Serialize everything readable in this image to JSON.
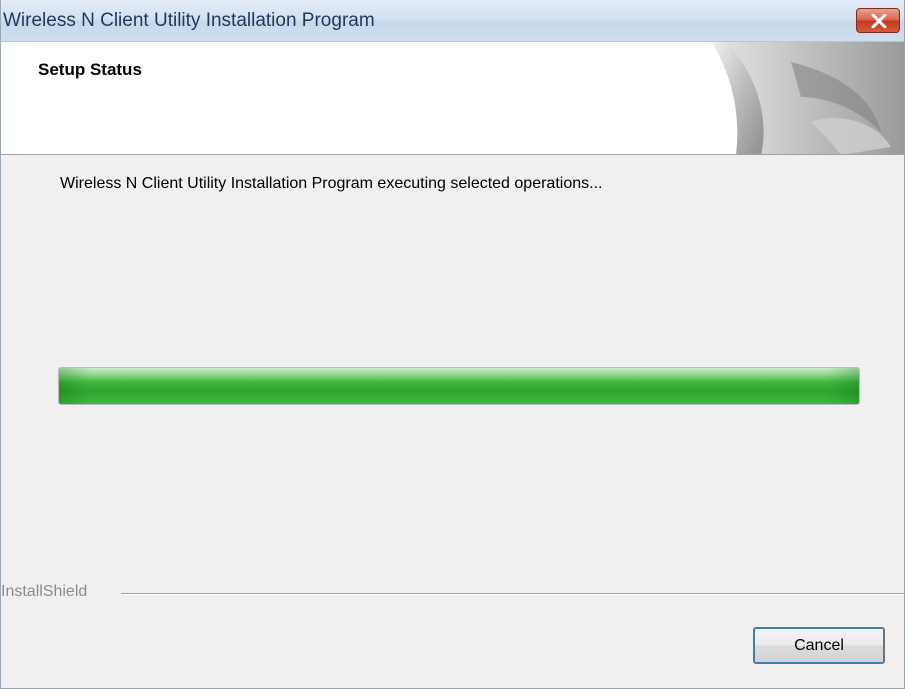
{
  "window": {
    "title": "Wireless N Client Utility Installation Program",
    "close_icon": "close-icon"
  },
  "header": {
    "title": "Setup Status",
    "graphic": "page-curl-graphic"
  },
  "main": {
    "status_text": "Wireless N Client Utility Installation Program executing selected operations...",
    "progress_percent": 100,
    "progress_color": "#34b034"
  },
  "footer": {
    "brand": "InstallShield",
    "cancel_label": "Cancel"
  }
}
